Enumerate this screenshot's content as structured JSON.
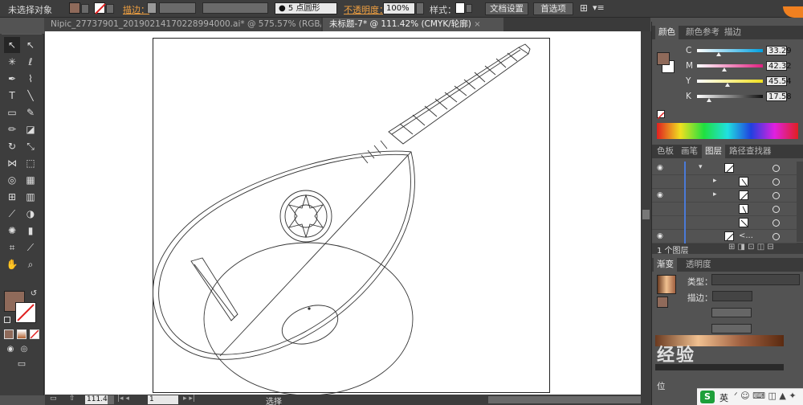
{
  "control_bar": {
    "selection_status": "未选择对象",
    "stroke_label": "描边：",
    "brush_label": "5 点圆形",
    "opacity_label": "不透明度：",
    "opacity_value": "100%",
    "style_label": "样式：",
    "doc_setup_button": "文档设置",
    "preferences_button": "首选项"
  },
  "tabs": [
    {
      "label": "Nipic_27737901_20190214170228994000.ai* @ 575.57% (RGB/预览)",
      "close": "×"
    },
    {
      "label": "未标题-7* @ 111.42% (CMYK/轮廓)",
      "close": "×"
    }
  ],
  "status_bar": {
    "zoom": "111.42",
    "page": "1",
    "tool_status": "选择"
  },
  "color_panel": {
    "tabs": [
      "颜色",
      "颜色参考",
      "描边"
    ],
    "sliders": [
      {
        "label": "C",
        "value": "33.29",
        "pos": 0.33
      },
      {
        "label": "M",
        "value": "42.32",
        "pos": 0.42
      },
      {
        "label": "Y",
        "value": "45.54",
        "pos": 0.46
      },
      {
        "label": "K",
        "value": "17.58",
        "pos": 0.18
      }
    ]
  },
  "layers_panel": {
    "tabs": [
      "色板",
      "画笔",
      "图层",
      "路径查找器"
    ],
    "footer": "1 个图层",
    "last_row_label": "<..."
  },
  "gradient_panel": {
    "tabs": [
      "渐变",
      "透明度"
    ],
    "type_label": "类型：",
    "stroke_label": "描边：",
    "position_label": "位"
  },
  "watermark": "经验",
  "ime": {
    "lang": "英"
  },
  "colors": {
    "fill": "#8f6a5a",
    "accent_orange": "#f0a040",
    "panel_bg": "#535353",
    "bar_bg": "#3d3d3d"
  }
}
